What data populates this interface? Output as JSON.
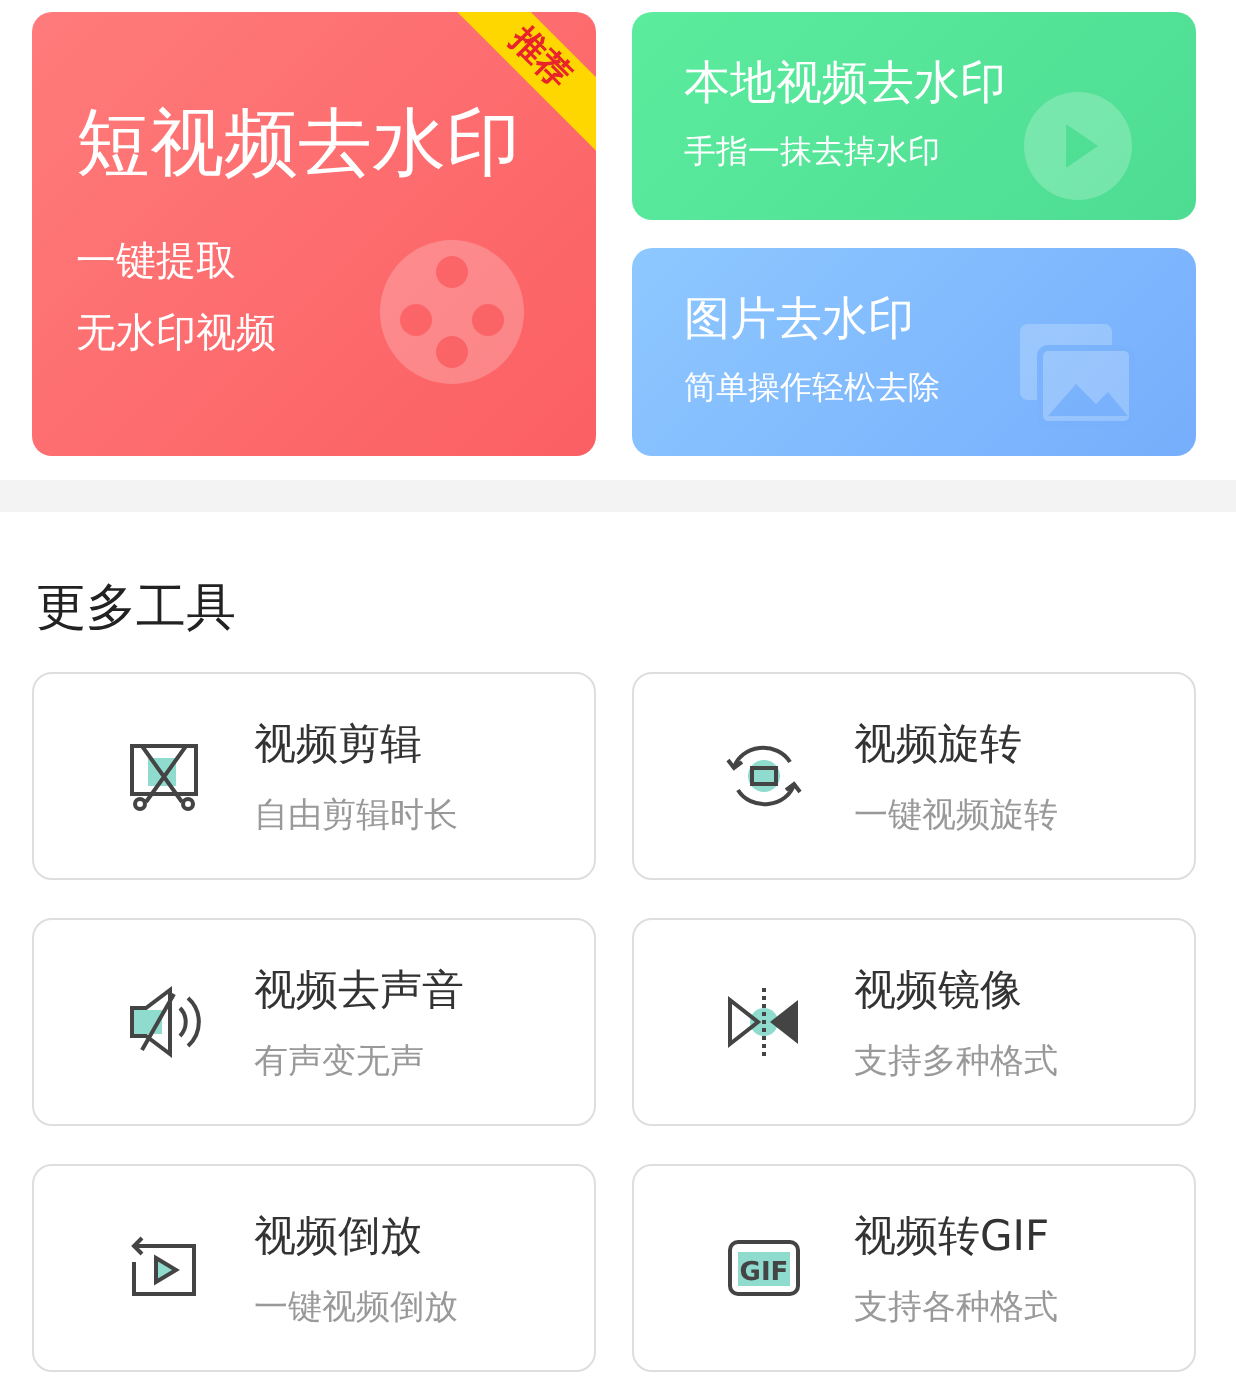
{
  "features": [
    {
      "kind": "video",
      "title": "短视频去水印",
      "lines": [
        "一键提取",
        "无水印视频"
      ],
      "badge": "推荐"
    },
    {
      "kind": "local",
      "title": "本地视频去水印",
      "lines": [
        "手指一抹去掉水印"
      ]
    },
    {
      "kind": "image",
      "title": "图片去水印",
      "lines": [
        "简单操作轻松去除"
      ]
    }
  ],
  "section_title": "更多工具",
  "tools": [
    {
      "kind": "cut",
      "title": "视频剪辑",
      "subtitle": "自由剪辑时长"
    },
    {
      "kind": "rotate",
      "title": "视频旋转",
      "subtitle": "一键视频旋转"
    },
    {
      "kind": "mute",
      "title": "视频去声音",
      "subtitle": "有声变无声"
    },
    {
      "kind": "mirror",
      "title": "视频镜像",
      "subtitle": "支持多种格式"
    },
    {
      "kind": "reverse",
      "title": "视频倒放",
      "subtitle": "一键视频倒放"
    },
    {
      "kind": "gif",
      "icon_label": "GIF",
      "title": "视频转GIF",
      "subtitle": "支持各种格式"
    }
  ]
}
